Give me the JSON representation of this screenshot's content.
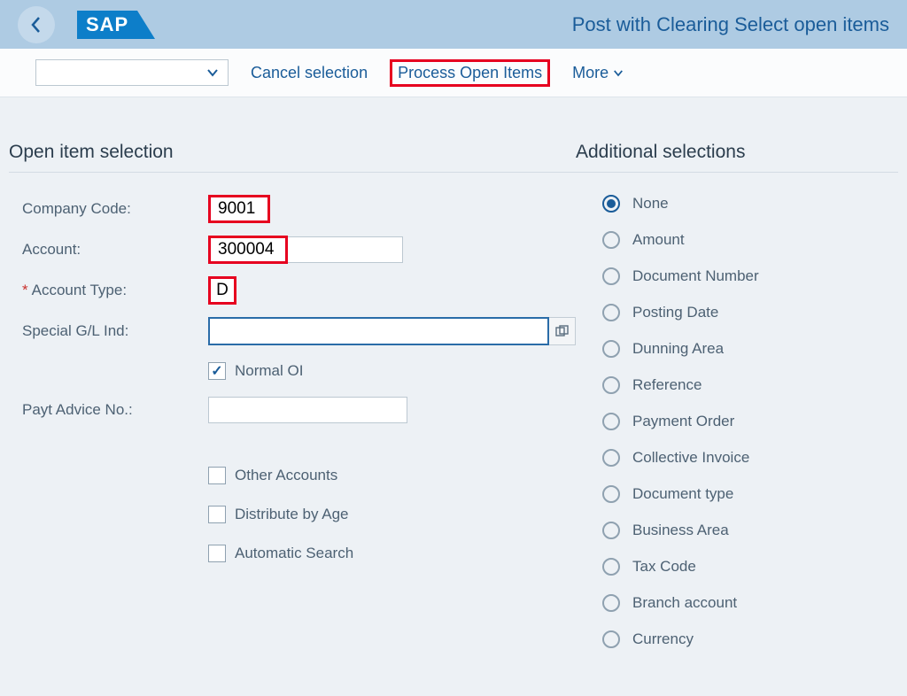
{
  "header": {
    "logo_text": "SAP",
    "page_title": "Post with Clearing Select open items"
  },
  "toolbar": {
    "cancel_selection": "Cancel selection",
    "process_open_items": "Process Open Items",
    "more": "More"
  },
  "sections": {
    "open_item": "Open item selection",
    "additional": "Additional selections"
  },
  "form": {
    "company_code_label": "Company Code:",
    "company_code_value": "9001",
    "account_label": "Account:",
    "account_value": "300004",
    "account_type_label": "Account Type:",
    "account_type_value": "D",
    "special_gl_label": "Special G/L Ind:",
    "special_gl_value": "",
    "normal_oi": "Normal OI",
    "payt_advice_label": "Payt Advice No.:",
    "payt_advice_value": "",
    "other_accounts": "Other Accounts",
    "distribute_by_age": "Distribute by Age",
    "automatic_search": "Automatic Search"
  },
  "additional_options": [
    "None",
    "Amount",
    "Document Number",
    "Posting Date",
    "Dunning Area",
    "Reference",
    "Payment Order",
    "Collective Invoice",
    "Document type",
    "Business Area",
    "Tax Code",
    "Branch account",
    "Currency"
  ],
  "additional_selected": 0
}
